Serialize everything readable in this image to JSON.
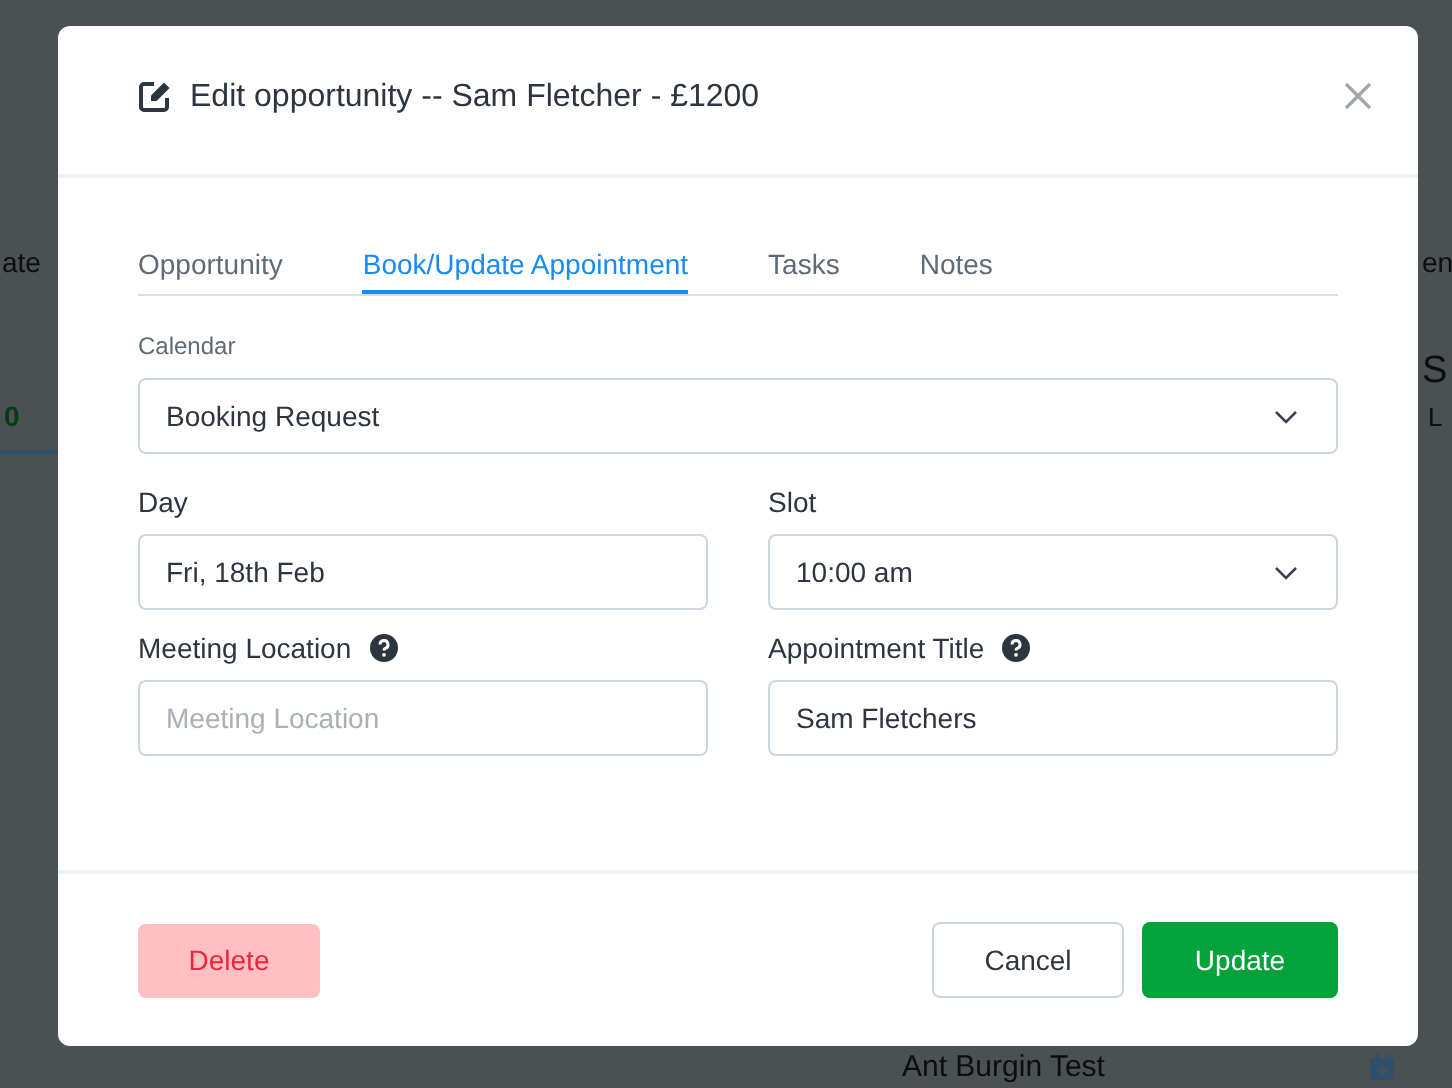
{
  "background": {
    "texts": [
      {
        "kind": "header",
        "text": "ate"
      },
      {
        "kind": "count",
        "text": "0"
      },
      {
        "kind": "header",
        "text": "en"
      },
      {
        "kind": "title",
        "text": "S"
      },
      {
        "kind": "sub",
        "text": "L"
      },
      {
        "kind": "name",
        "text": "Ant Burgin Test"
      }
    ]
  },
  "modal": {
    "title": "Edit opportunity -- Sam Fletcher - £1200",
    "tabs": [
      {
        "label": "Opportunity",
        "selected": false
      },
      {
        "label": "Book/Update Appointment",
        "selected": true
      },
      {
        "label": "Tasks",
        "selected": false
      },
      {
        "label": "Notes",
        "selected": false
      }
    ],
    "calendar": {
      "label": "Calendar",
      "value": "Booking Request"
    },
    "fields": [
      {
        "kind": "input",
        "label": "Day",
        "value": "Fri, 18th Feb",
        "help": false
      },
      {
        "kind": "select",
        "label": "Slot",
        "value": "10:00 am",
        "help": false
      },
      {
        "kind": "input",
        "label": "Meeting Location",
        "placeholder": "Meeting Location",
        "help": true
      },
      {
        "kind": "input",
        "label": "Appointment Title",
        "value": "Sam Fletchers",
        "help": true
      }
    ],
    "buttons": [
      {
        "kind": "danger",
        "label": "Delete"
      },
      {
        "kind": "secondary",
        "label": "Cancel"
      },
      {
        "kind": "primary",
        "label": "Update"
      }
    ]
  }
}
